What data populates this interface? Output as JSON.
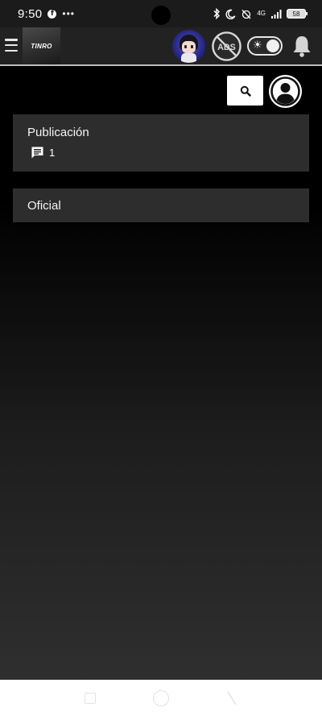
{
  "status_bar": {
    "time": "9:50",
    "network": "4G",
    "battery": "58",
    "icons": [
      "facebook-icon",
      "more-icon",
      "bluetooth-icon",
      "moon-icon",
      "alarm-off-icon",
      "signal-icon",
      "battery-icon"
    ]
  },
  "header": {
    "logo_text": "TINRO",
    "ads_label": "ADS",
    "icons": [
      "menu-icon",
      "avatar",
      "no-ads-icon",
      "theme-toggle",
      "bell-icon"
    ]
  },
  "actions": {
    "icons": [
      "search-icon",
      "account-icon"
    ]
  },
  "cards": [
    {
      "title": "Publicación",
      "comment_count": "1"
    },
    {
      "title": "Oficial"
    }
  ],
  "colors": {
    "background": "#000000",
    "header": "#222222",
    "card": "#2d2d2d",
    "text": "#ffffff"
  }
}
